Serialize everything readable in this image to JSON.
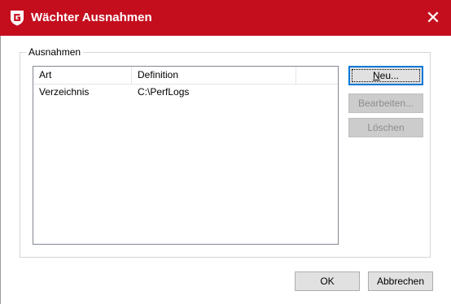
{
  "window": {
    "title": "Wächter Ausnahmen",
    "close_glyph": "✕",
    "brand_color": "#c40e1e"
  },
  "group": {
    "label": "Ausnahmen"
  },
  "table": {
    "columns": [
      "Art",
      "Definition"
    ],
    "rows": [
      {
        "art": "Verzeichnis",
        "definition": "C:\\PerfLogs"
      }
    ]
  },
  "side_buttons": {
    "neu": {
      "accel": "N",
      "rest": "eu..."
    },
    "bearbeiten": "Bearbeiten...",
    "loeschen": "Löschen"
  },
  "footer": {
    "ok": "OK",
    "cancel": "Abbrechen"
  },
  "icons": {
    "logo": "gdata-g-shield-icon",
    "close": "close-icon"
  }
}
